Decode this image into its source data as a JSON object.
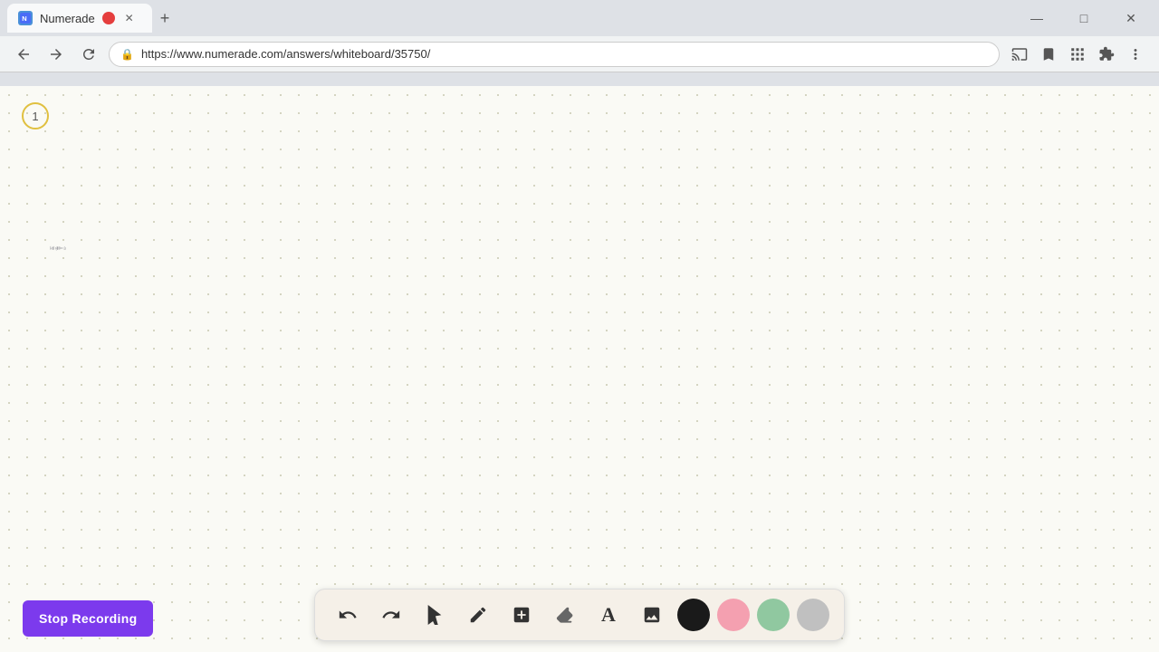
{
  "browser": {
    "tab": {
      "title": "Numerade",
      "favicon_text": "N",
      "recording_dot": true
    },
    "address": "https://www.numerade.com/answers/whiteboard/35750/",
    "window_controls": {
      "minimize": "—",
      "maximize": "□",
      "close": "✕"
    }
  },
  "whiteboard": {
    "page_number": "1",
    "math_expression": "(a)  g(0) = -3",
    "background": "#fafaf5"
  },
  "toolbar": {
    "buttons": [
      {
        "name": "undo",
        "icon": "↺",
        "label": "Undo"
      },
      {
        "name": "redo",
        "icon": "↻",
        "label": "Redo"
      },
      {
        "name": "select",
        "icon": "▲",
        "label": "Select"
      },
      {
        "name": "pen",
        "icon": "✏",
        "label": "Pen"
      },
      {
        "name": "add",
        "icon": "+",
        "label": "Add"
      },
      {
        "name": "eraser",
        "icon": "◻",
        "label": "Eraser"
      },
      {
        "name": "text",
        "icon": "A",
        "label": "Text"
      },
      {
        "name": "image",
        "icon": "🖼",
        "label": "Image"
      }
    ],
    "colors": [
      {
        "name": "black",
        "value": "#1a1a1a"
      },
      {
        "name": "pink",
        "value": "#f4a0b0"
      },
      {
        "name": "green",
        "value": "#90c8a0"
      },
      {
        "name": "gray",
        "value": "#c0c0c0"
      }
    ]
  },
  "stop_recording": {
    "label": "Stop Recording",
    "bg_color": "#7c3aed"
  }
}
